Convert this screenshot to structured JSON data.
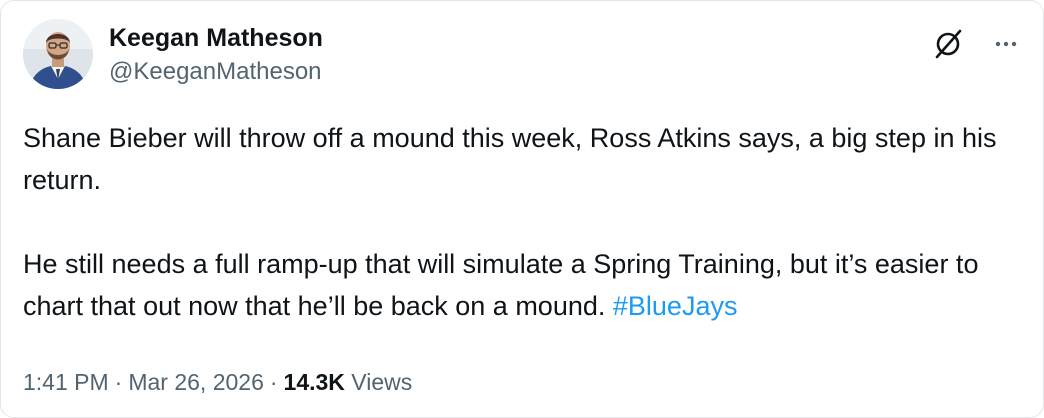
{
  "author": {
    "display_name": "Keegan Matheson",
    "handle": "@KeeganMatheson"
  },
  "icons": {
    "avatar": "profile-photo",
    "grok": "grok-icon",
    "more": "more-options-icon"
  },
  "tweet": {
    "paragraph_1": "Shane Bieber will throw off a mound this week, Ross Atkins says, a big step in his return.",
    "paragraph_2_text": "He still needs a full ramp-up that will simulate a Spring Training, but it’s easier to chart that out now that he’ll be back on a mound.",
    "hashtag": "#BlueJays"
  },
  "meta": {
    "time": "1:41 PM",
    "separator": "·",
    "date": "Mar 26, 2026",
    "views_count": "14.3K",
    "views_label": "Views"
  },
  "colors": {
    "text": "#0f1419",
    "secondary": "#536471",
    "link": "#1d9bf0",
    "border": "#e3e6e9"
  }
}
